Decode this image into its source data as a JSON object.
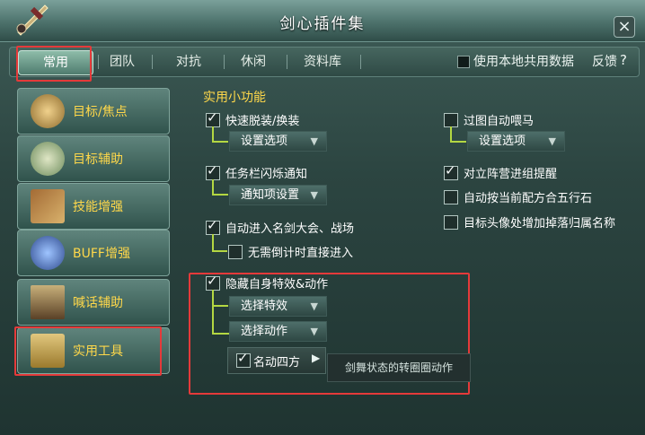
{
  "window": {
    "title": "剑心插件集",
    "close_icon": "close-icon"
  },
  "tabs": [
    {
      "label": "常用",
      "active": true
    },
    {
      "label": "团队"
    },
    {
      "label": "对抗"
    },
    {
      "label": "休闲"
    },
    {
      "label": "资料库"
    }
  ],
  "header_right": {
    "share_label": "使用本地共用数据",
    "feedback_label": "反馈",
    "help_label": "?"
  },
  "sidebar": [
    {
      "label": "目标/焦点",
      "icon": "target-warrior-icon"
    },
    {
      "label": "目标辅助",
      "icon": "helper-character-icon"
    },
    {
      "label": "技能增强",
      "icon": "skill-book-icon"
    },
    {
      "label": "BUFF增强",
      "icon": "buff-character-icon"
    },
    {
      "label": "喊话辅助",
      "icon": "gate-icon"
    },
    {
      "label": "实用工具",
      "icon": "tool-icon"
    }
  ],
  "main": {
    "section_title": "实用小功能",
    "left": {
      "quick_swap": {
        "label": "快速脱装/换装",
        "checked": true,
        "dropdown": "设置选项"
      },
      "taskbar_flash": {
        "label": "任务栏闪烁通知",
        "checked": true,
        "dropdown": "通知项设置"
      },
      "auto_enter": {
        "label": "自动进入名剑大会、战场",
        "checked": true,
        "sub": {
          "label": "无需倒计时直接进入",
          "checked": false
        }
      },
      "hide_effects": {
        "label": "隐藏自身特效&动作",
        "checked": true,
        "effect_dropdown": "选择特效",
        "action_dropdown": "选择动作",
        "sub_item": {
          "label": "名动四方",
          "checked": true
        },
        "tooltip": "剑舞状态的转圈圈动作"
      }
    },
    "right": {
      "auto_feed": {
        "label": "过图自动喂马",
        "checked": false,
        "dropdown": "设置选项"
      },
      "pvp_remind": {
        "label": "对立阵营进组提醒",
        "checked": true
      },
      "auto_combine": {
        "label": "自动按当前配方合五行石",
        "checked": false
      },
      "drop_owner": {
        "label": "目标头像处增加掉落归属名称",
        "checked": false
      }
    }
  }
}
